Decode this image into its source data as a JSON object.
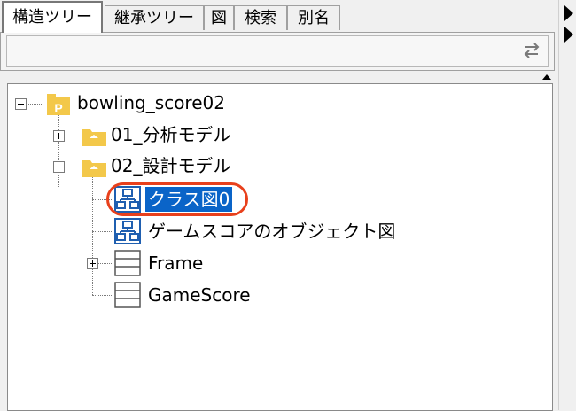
{
  "tabs": [
    {
      "label": "構造ツリー",
      "active": true
    },
    {
      "label": "継承ツリー",
      "active": false
    },
    {
      "label": "図",
      "active": false
    },
    {
      "label": "検索",
      "active": false
    },
    {
      "label": "別名",
      "active": false
    }
  ],
  "toolbar": {
    "sync_icon": "sync-arrows-icon"
  },
  "tree": {
    "root": {
      "label": "bowling_score02",
      "icon": "package-icon",
      "expanded": true
    },
    "children": [
      {
        "label": "01_分析モデル",
        "icon": "folder-icon",
        "expanded": false
      },
      {
        "label": "02_設計モデル",
        "icon": "folder-icon",
        "expanded": true,
        "children": [
          {
            "label": "クラス図0",
            "icon": "class-diagram-icon",
            "selected": true
          },
          {
            "label": "ゲームスコアのオブジェクト図",
            "icon": "class-diagram-icon",
            "selected": false
          },
          {
            "label": "Frame",
            "icon": "class-icon",
            "expanded": false
          },
          {
            "label": "GameScore",
            "icon": "class-icon"
          }
        ]
      }
    ]
  },
  "colors": {
    "selection": "#0a64c8",
    "highlight_ring": "#e8401c",
    "folder": "#f3c84a",
    "diagram": "#1f5fb0"
  }
}
